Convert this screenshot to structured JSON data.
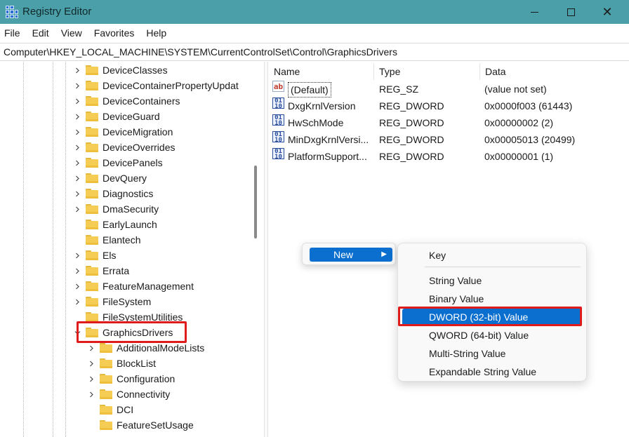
{
  "window": {
    "title": "Registry Editor",
    "minimize_icon": "minimize-icon",
    "maximize_icon": "maximize-icon",
    "close_glyph": "✕"
  },
  "menu": [
    "File",
    "Edit",
    "View",
    "Favorites",
    "Help"
  ],
  "address": "Computer\\HKEY_LOCAL_MACHINE\\SYSTEM\\CurrentControlSet\\Control\\GraphicsDrivers",
  "tree": {
    "items": [
      {
        "label": "DeviceClasses",
        "expandable": true
      },
      {
        "label": "DeviceContainerPropertyUpdat",
        "expandable": true
      },
      {
        "label": "DeviceContainers",
        "expandable": true
      },
      {
        "label": "DeviceGuard",
        "expandable": true
      },
      {
        "label": "DeviceMigration",
        "expandable": true
      },
      {
        "label": "DeviceOverrides",
        "expandable": true
      },
      {
        "label": "DevicePanels",
        "expandable": true
      },
      {
        "label": "DevQuery",
        "expandable": true
      },
      {
        "label": "Diagnostics",
        "expandable": true
      },
      {
        "label": "DmaSecurity",
        "expandable": true
      },
      {
        "label": "EarlyLaunch",
        "expandable": false
      },
      {
        "label": "Elantech",
        "expandable": false
      },
      {
        "label": "Els",
        "expandable": true
      },
      {
        "label": "Errata",
        "expandable": true
      },
      {
        "label": "FeatureManagement",
        "expandable": true
      },
      {
        "label": "FileSystem",
        "expandable": true
      },
      {
        "label": "FileSystemUtilities",
        "expandable": false
      },
      {
        "label": "GraphicsDrivers",
        "expandable": true,
        "expanded": true,
        "selected": true
      }
    ],
    "children": [
      {
        "label": "AdditionalModeLists",
        "expandable": true
      },
      {
        "label": "BlockList",
        "expandable": true
      },
      {
        "label": "Configuration",
        "expandable": true
      },
      {
        "label": "Connectivity",
        "expandable": true
      },
      {
        "label": "DCI",
        "expandable": false
      },
      {
        "label": "FeatureSetUsage",
        "expandable": false
      }
    ]
  },
  "list": {
    "columns": [
      "Name",
      "Type",
      "Data"
    ],
    "rows": [
      {
        "name": "(Default)",
        "type": "REG_SZ",
        "data": "(value not set)",
        "icon": "string-value-icon"
      },
      {
        "name": "DxgKrnlVersion",
        "type": "REG_DWORD",
        "data": "0x0000f003 (61443)",
        "icon": "binary-value-icon"
      },
      {
        "name": "HwSchMode",
        "type": "REG_DWORD",
        "data": "0x00000002 (2)",
        "icon": "binary-value-icon"
      },
      {
        "name": "MinDxgKrnlVersi...",
        "type": "REG_DWORD",
        "data": "0x00005013 (20499)",
        "icon": "binary-value-icon"
      },
      {
        "name": "PlatformSupport...",
        "type": "REG_DWORD",
        "data": "0x00000001 (1)",
        "icon": "binary-value-icon"
      }
    ]
  },
  "context_menu": {
    "new_label": "New",
    "submenu": [
      "Key",
      "String Value",
      "Binary Value",
      "DWORD (32-bit) Value",
      "QWORD (64-bit) Value",
      "Multi-String Value",
      "Expandable String Value"
    ],
    "selected_index": 3
  },
  "colors": {
    "titlebar": "#4b9fa8",
    "accent": "#0b6fcf",
    "annotation": "#e01b1b",
    "folder": "#f6cd54"
  }
}
